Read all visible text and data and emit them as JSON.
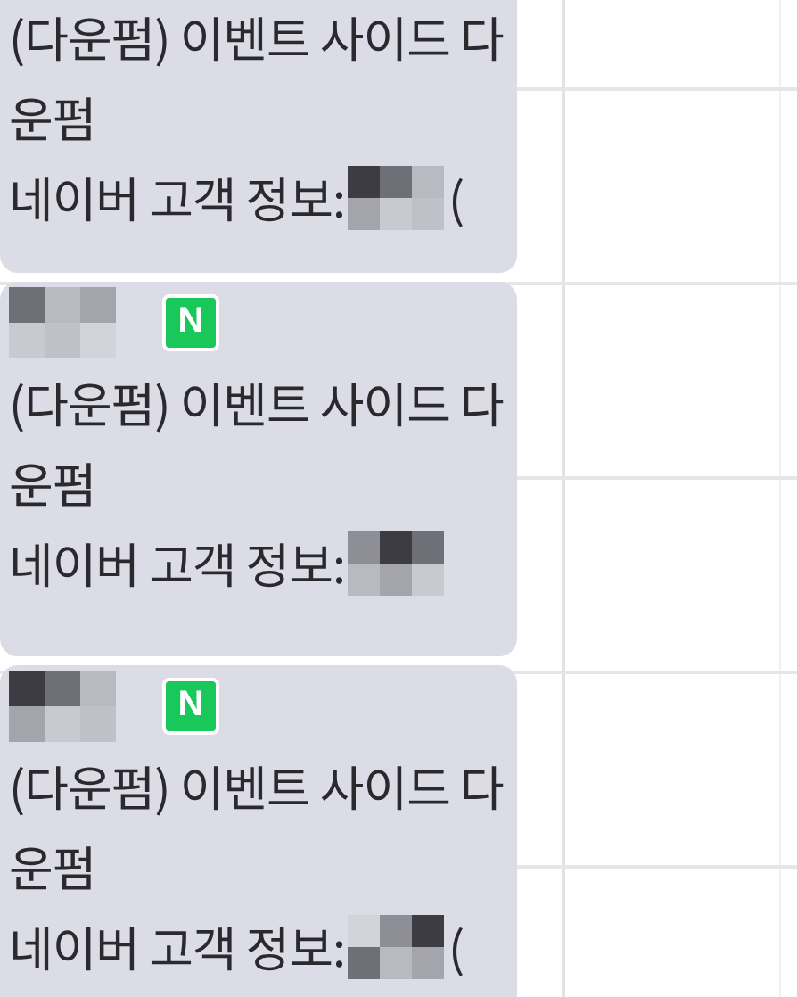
{
  "events": [
    {
      "title_lines": [
        "(다운펌) 이벤트 사이드 다",
        "운펌"
      ],
      "info_label": "네이버 고객 정보:",
      "info_tail": "("
    },
    {
      "badge": "N",
      "title_lines": [
        "(다운펌) 이벤트 사이드 다",
        "운펌"
      ],
      "info_label": "네이버 고객 정보:"
    },
    {
      "badge": "N",
      "title_lines": [
        "(다운펌) 이벤트 사이드 다",
        "운펌"
      ],
      "info_label": "네이버 고객 정보:",
      "info_tail": "("
    }
  ]
}
